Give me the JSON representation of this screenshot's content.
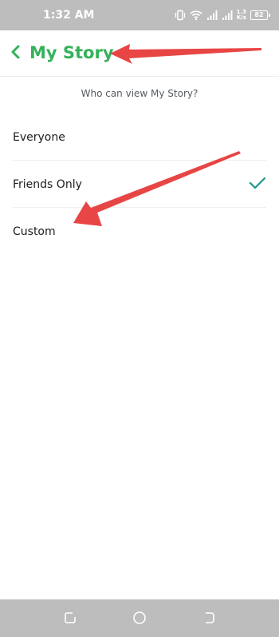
{
  "status_bar": {
    "time": "1:32 AM",
    "net_speed_value": "1.3",
    "net_speed_unit": "K/s",
    "battery": "82",
    "icons": [
      "vibrate-icon",
      "wifi-icon",
      "signal-icon",
      "signal-icon"
    ]
  },
  "header": {
    "back_icon": "chevron-left-icon",
    "title": "My Story"
  },
  "subtitle": "Who can view My Story?",
  "options": [
    {
      "label": "Everyone",
      "selected": false
    },
    {
      "label": "Friends Only",
      "selected": true
    },
    {
      "label": "Custom",
      "selected": false
    }
  ],
  "nav_bar": {
    "buttons": [
      "recents-icon",
      "home-icon",
      "back-icon"
    ]
  },
  "colors": {
    "accent": "#34b25a",
    "check": "#179788",
    "annotation_arrow": "#e84545",
    "system_bar": "#bdbdbd"
  }
}
